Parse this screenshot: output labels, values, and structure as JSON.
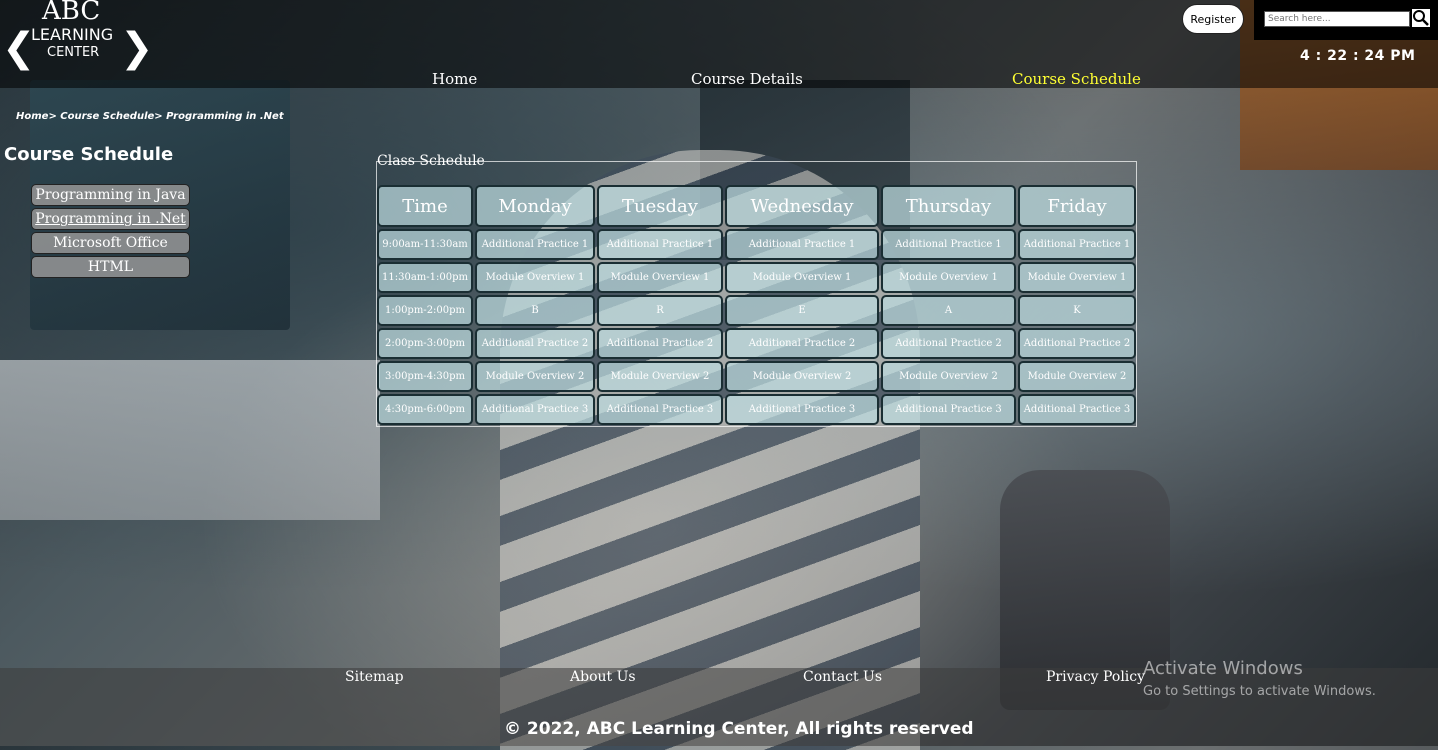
{
  "logo": {
    "line1": "ABC",
    "line2": "LEARNING",
    "line3": "CENTER",
    "prev_arrow": "❮",
    "next_arrow": "❯"
  },
  "nav": {
    "home": "Home",
    "course_details": "Course Details",
    "course_schedule": "Course Schedule"
  },
  "header": {
    "register": "Register",
    "search_placeholder": "Search here...",
    "clock": "4 : 22 : 24 PM"
  },
  "breadcrumb": "Home> Course Schedule> Programming in .Net",
  "sidebar": {
    "title": "Course Schedule",
    "items": [
      "Programming in Java",
      "Programming in .Net",
      "Microsoft Office",
      "HTML"
    ]
  },
  "schedule": {
    "legend": "Class Schedule",
    "headers": [
      "Time",
      "Monday",
      "Tuesday",
      "Wednesday",
      "Thursday",
      "Friday"
    ],
    "rows": [
      [
        "9:00am-11:30am",
        "Additional Practice 1",
        "Additional Practice 1",
        "Additional Practice 1",
        "Additional Practice 1",
        "Additional Practice 1"
      ],
      [
        "11:30am-1:00pm",
        "Module Overview 1",
        "Module Overview 1",
        "Module Overview 1",
        "Module Overview 1",
        "Module Overview 1"
      ],
      [
        "1:00pm-2:00pm",
        "B",
        "R",
        "E",
        "A",
        "K"
      ],
      [
        "2:00pm-3:00pm",
        "Additional Practice 2",
        "Additional Practice 2",
        "Additional Practice 2",
        "Additional Practice 2",
        "Additional Practice 2"
      ],
      [
        "3:00pm-4:30pm",
        "Module Overview 2",
        "Module Overview 2",
        "Module Overview 2",
        "Module Overview 2",
        "Module Overview 2"
      ],
      [
        "4:30pm-6:00pm",
        "Additional Practice 3",
        "Additional Practice 3",
        "Additional Practice 3",
        "Additional Practice 3",
        "Additional Practice 3"
      ]
    ]
  },
  "footer": {
    "sitemap": "Sitemap",
    "about": "About Us",
    "contact": "Contact Us",
    "privacy": "Privacy Policy",
    "copyright": "© 2022, ABC Learning Center, All rights reserved"
  },
  "watermark": {
    "title": "Activate Windows",
    "subtitle": "Go to Settings to activate Windows."
  },
  "colors": {
    "active_nav": "#ffff33",
    "cell_bg": "#bedce1",
    "cell_border": "#1a2e33"
  }
}
